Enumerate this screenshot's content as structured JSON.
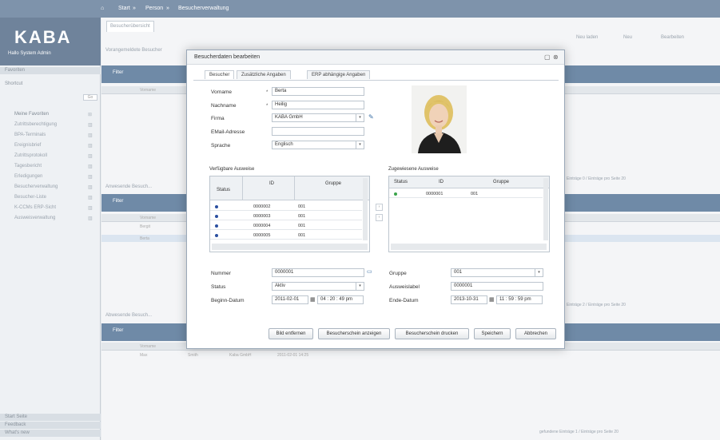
{
  "topbar": {
    "start": "Start",
    "person": "Person",
    "module": "Besucherverwaltung"
  },
  "sidebar": {
    "logo": "KABA",
    "user": "Hallo System Admin",
    "section": "Favoriten",
    "shortcut_label": "Shortcut",
    "items": [
      "Meine Favoriten",
      "Zutrittsberechtigung",
      "BPA-Terminals",
      "Ereignisbrief",
      "Zutrittsprotokoll",
      "Tagesbericht",
      "Erledigungen",
      "Besucherverwaltung",
      "Besucher-Liste",
      "K-CCMs ERP-Sicht",
      "Ausweisverwaltung"
    ],
    "footer": [
      "Start Seite",
      "Feedback",
      "What's new"
    ]
  },
  "main": {
    "breadcrumb": "Besucherübersicht",
    "toolbar": [
      "Neu laden",
      "Neu",
      "Bearbeiten"
    ],
    "section_label": "Vorangemeldete Besucher",
    "filter": "Filter",
    "panels": [
      "Anwesende Besuch...",
      "Abwesende Besuch..."
    ],
    "col_name": "Vorname",
    "row_values": [
      "Bergit",
      "Berta",
      "Max",
      "Smith",
      "Kaba GmbH",
      "2011-02-01 14:25"
    ],
    "pager1": "Einträge 0  / Einträge pro Seite  20",
    "pager2": "Einträge 2  / Einträge pro Seite  20",
    "pager3": "gefundene Einträge 1  / Einträge pro Seite  20"
  },
  "dialog": {
    "title": "Besucherdaten bearbeiten",
    "tabs": [
      "Besucher",
      "Zusätzliche Angaben",
      "ERP abhängige Angaben"
    ],
    "fields": {
      "vorname_label": "Vorname",
      "vorname": "Berta",
      "nachname_label": "Nachname",
      "nachname": "Heilig",
      "firma_label": "Firma",
      "firma": "KABA GmbH",
      "email_label": "EMail-Adresse",
      "email": "",
      "sprache_label": "Sprache",
      "sprache": "Englisch"
    },
    "verfuegbar_title": "Verfügbare Ausweise",
    "zugewiesen_title": "Zugewiesene Ausweise",
    "col_status": "Status",
    "col_id": "ID",
    "col_gruppe": "Gruppe",
    "verfuegbar_rows": [
      {
        "id": "0000002",
        "gruppe": "001"
      },
      {
        "id": "0000003",
        "gruppe": "001"
      },
      {
        "id": "0000004",
        "gruppe": "001"
      },
      {
        "id": "0000005",
        "gruppe": "001"
      }
    ],
    "zugewiesen_rows": [
      {
        "id": "0000001",
        "gruppe": "001"
      }
    ],
    "lower": {
      "nummer_label": "Nummer",
      "nummer": "0000001",
      "status_label": "Status",
      "status": "Aktiv",
      "beginn_label": "Beginn-Datum",
      "beginn_date": "2011-02-01",
      "beginn_time": "04 : 20 : 49  pm",
      "gruppe_label": "Gruppe",
      "gruppe": "001",
      "ausweis_label": "Ausweislabel",
      "ausweis": "0000001",
      "ende_label": "Ende-Datum",
      "ende_date": "2013-10-31",
      "ende_time": "11 : 59 : 59  pm"
    },
    "buttons": [
      "Bild entfernen",
      "Besucherschein anzeigen",
      "Besucherschein drucken",
      "Speichern",
      "Abbrechen"
    ]
  },
  "colors": {
    "header": "#6f8aa7",
    "topbar": "#7e93ab",
    "status_dot": "#2b4fa0",
    "status_green": "#3aa44a"
  }
}
